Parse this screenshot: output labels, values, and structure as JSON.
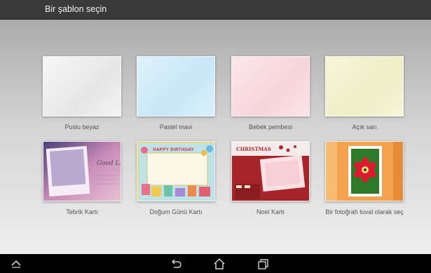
{
  "header": {
    "title": "Bir şablon seçin"
  },
  "templates": [
    {
      "label": "Puslu beyaz"
    },
    {
      "label": "Pastel mavi"
    },
    {
      "label": "Bebek pembesi"
    },
    {
      "label": "Açık sarı"
    },
    {
      "label": "Tebrik Kartı",
      "card_text": "Good Luck"
    },
    {
      "label": "Doğum Günü Kartı",
      "card_text": "HAPPY BIRTHDAY"
    },
    {
      "label": "Noel Kartı",
      "card_text": "CHRISTMAS"
    },
    {
      "label": "Bir fotoğrafı tuval olarak seç"
    }
  ],
  "navbar": {
    "icons": [
      "up-chevron-icon",
      "back-icon",
      "home-icon",
      "recent-apps-icon"
    ]
  }
}
